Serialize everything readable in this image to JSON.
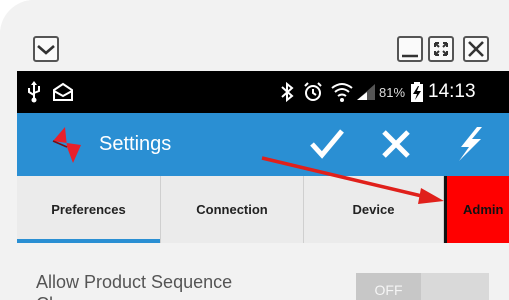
{
  "window": {
    "collapse_icon": "chevron-down-icon",
    "minimize_icon": "minimize-icon",
    "fullscreen_icon": "fullscreen-icon",
    "close_icon": "close-icon"
  },
  "status_bar": {
    "icons": [
      "usb-icon",
      "envelope-icon",
      "bluetooth-icon",
      "alarm-icon",
      "wifi-icon",
      "signal-icon",
      "battery-charging-icon"
    ],
    "battery_percent": "81%",
    "time": "14:13"
  },
  "action_bar": {
    "title": "Settings",
    "accent": "#2a8fd3",
    "actions": [
      "check-icon",
      "close-icon",
      "lightning-icon"
    ]
  },
  "tabs": [
    {
      "label": "Preferences",
      "active": true
    },
    {
      "label": "Connection",
      "active": false
    },
    {
      "label": "Device",
      "active": false
    },
    {
      "label": "Admin",
      "active": false,
      "highlight": "#ff0000"
    }
  ],
  "settings": {
    "allow_product_sequence": {
      "label": "Allow Product Sequence",
      "label_line2": "Ch",
      "toggle_state": "OFF"
    }
  },
  "annotation": {
    "color": "#e0201b"
  }
}
